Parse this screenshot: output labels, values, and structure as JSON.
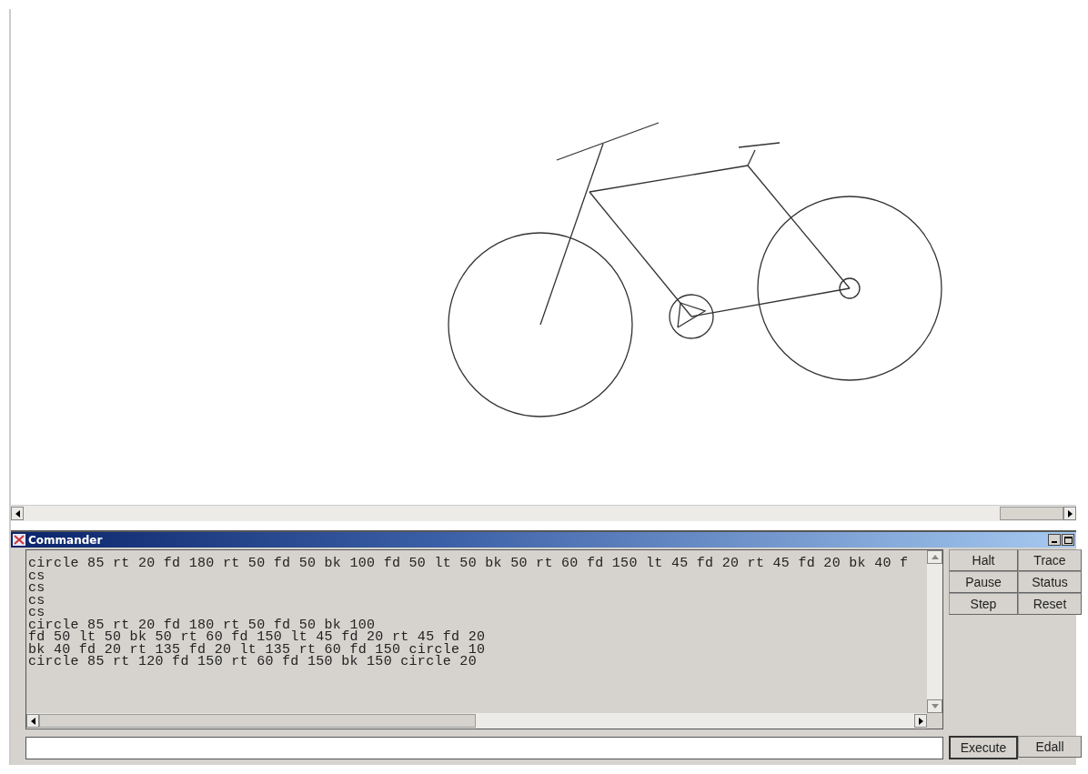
{
  "commander": {
    "title": "Commander",
    "history": [
      "circle 85 rt 20 fd 180 rt 50 fd 50 bk 100 fd 50 lt 50 bk 50 rt 60 fd 150 lt 45 fd 20 rt 45 fd 20 bk 40 f",
      "cs",
      "cs",
      "cs",
      "cs",
      "circle 85 rt 20 fd 180 rt 50 fd 50 bk 100",
      "fd 50 lt 50 bk 50 rt 60 fd 150 lt 45 fd 20 rt 45 fd 20",
      "bk 40 fd 20 rt 135 fd 20 lt 135 rt 60 fd 150 circle 10",
      "circle 85 rt 120 fd 150 rt 60 fd 150 bk 150 circle 20"
    ],
    "buttons": [
      "Halt",
      "Trace",
      "Pause",
      "Status",
      "Step",
      "Reset"
    ],
    "bottom_buttons": [
      "Execute",
      "Edall"
    ]
  }
}
